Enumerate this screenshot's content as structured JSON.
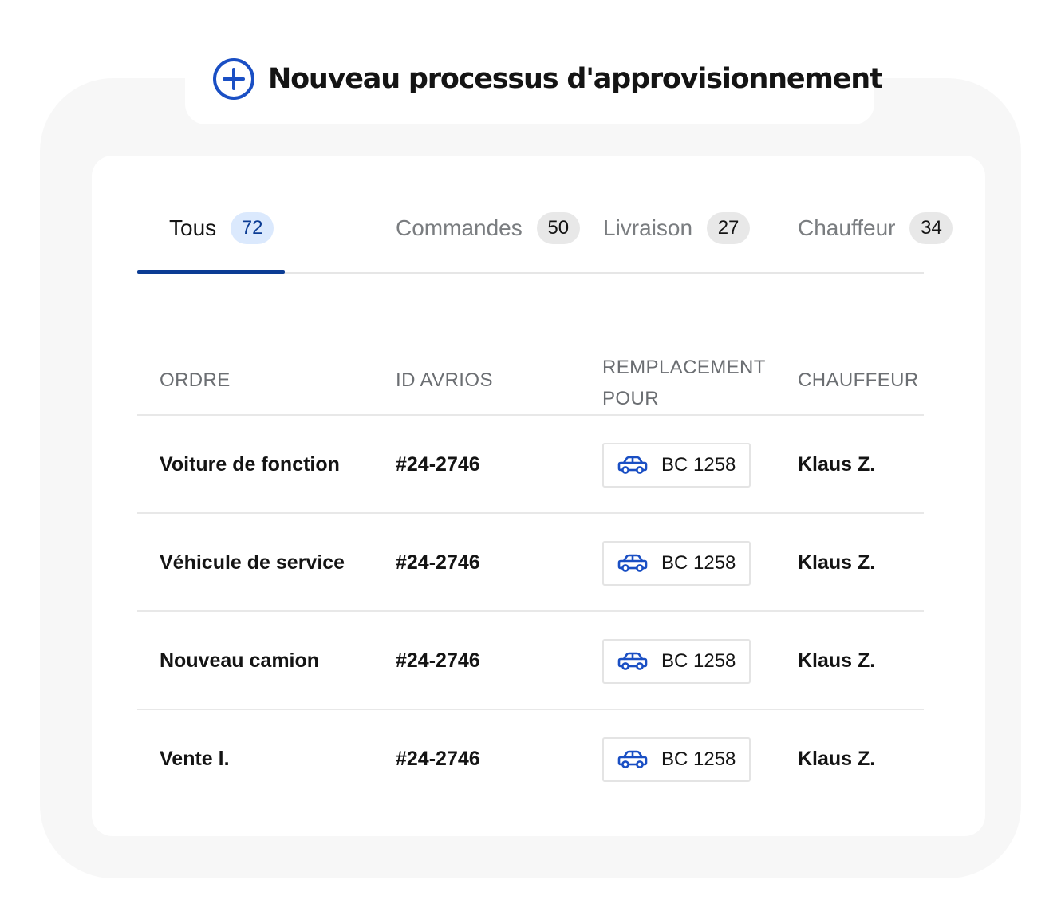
{
  "header": {
    "title": "Nouveau processus d'approvisionnement",
    "accent_color": "#0b3c94"
  },
  "tabs": [
    {
      "label": "Tous",
      "count": "72",
      "active": true
    },
    {
      "label": "Commandes",
      "count": "50",
      "active": false
    },
    {
      "label": "Livraison",
      "count": "27",
      "active": false
    },
    {
      "label": "Chauffeur",
      "count": "34",
      "active": false
    }
  ],
  "table": {
    "columns": [
      "ORDRE",
      "ID AVRIOS",
      "REMPLACEMENT",
      "POUR",
      "CHAUFFEUR"
    ],
    "rows": [
      {
        "ordre": "Voiture de fonction",
        "id": "#24-2746",
        "remplacement": "BC 1258",
        "chauffeur": "Klaus Z."
      },
      {
        "ordre": "Véhicule de service",
        "id": "#24-2746",
        "remplacement": "BC 1258",
        "chauffeur": "Klaus Z."
      },
      {
        "ordre": "Nouveau camion",
        "id": "#24-2746",
        "remplacement": "BC 1258",
        "chauffeur": "Klaus Z."
      },
      {
        "ordre": "Vente l.",
        "id": "#24-2746",
        "remplacement": "BC 1258",
        "chauffeur": "Klaus Z."
      }
    ]
  },
  "icons": {
    "header_icon": "plus-circle-icon",
    "row_icon": "car-icon",
    "icon_color": "#1a4fc4"
  }
}
